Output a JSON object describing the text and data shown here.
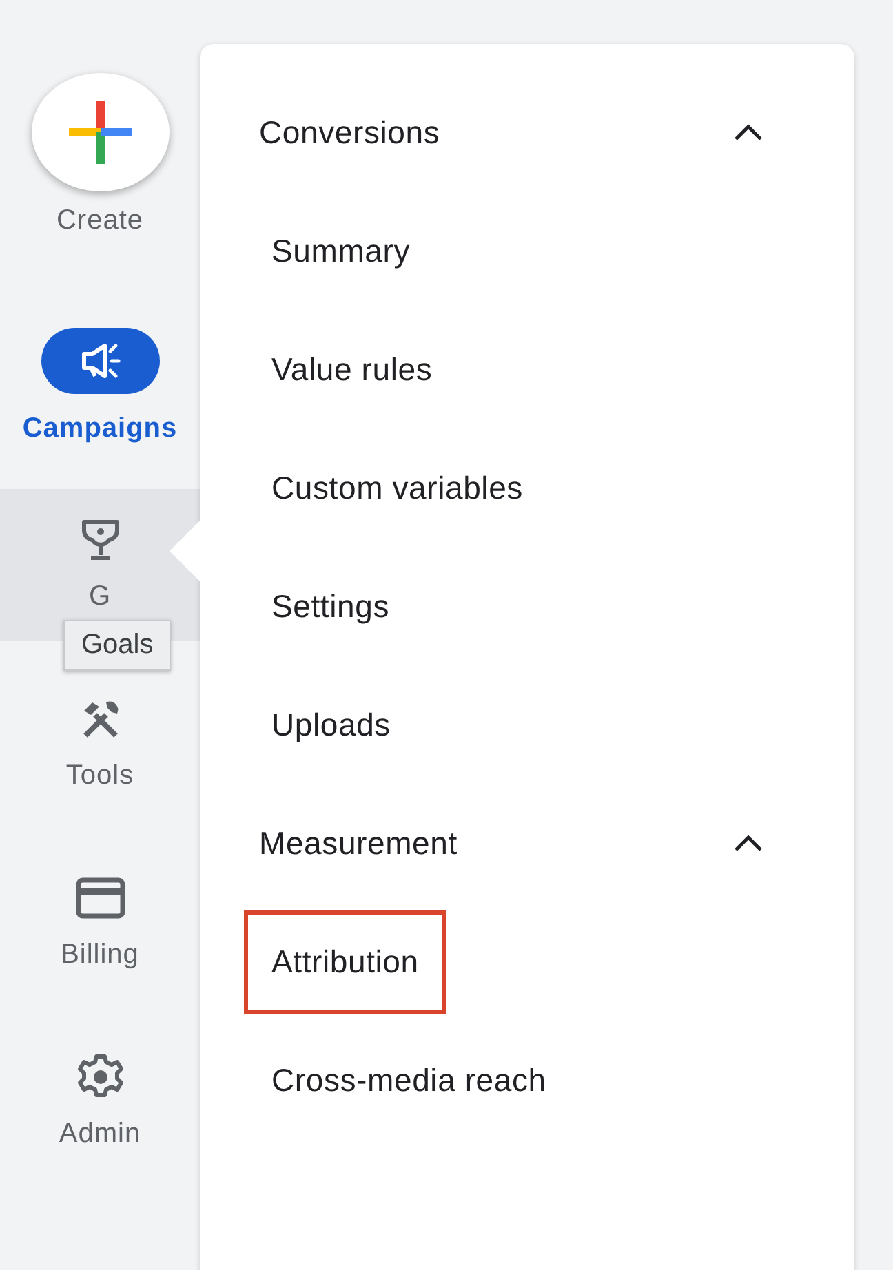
{
  "create": {
    "label": "Create"
  },
  "nav": [
    {
      "kind": "campaigns",
      "label": "Campaigns",
      "selected": true,
      "hovered": false
    },
    {
      "kind": "goals",
      "label": "G",
      "selected": false,
      "hovered": true
    },
    {
      "kind": "tools",
      "label": "Tools",
      "selected": false,
      "hovered": false
    },
    {
      "kind": "billing",
      "label": "Billing",
      "selected": false,
      "hovered": false
    },
    {
      "kind": "admin",
      "label": "Admin",
      "selected": false,
      "hovered": false
    }
  ],
  "tooltip": "Goals",
  "menu": [
    {
      "title": "Conversions",
      "expanded": true,
      "items": [
        {
          "label": "Summary",
          "highlighted": false
        },
        {
          "label": "Value rules",
          "highlighted": false
        },
        {
          "label": "Custom variables",
          "highlighted": false
        },
        {
          "label": "Settings",
          "highlighted": false
        },
        {
          "label": "Uploads",
          "highlighted": false
        }
      ]
    },
    {
      "title": "Measurement",
      "expanded": true,
      "items": [
        {
          "label": "Attribution",
          "highlighted": true
        },
        {
          "label": "Cross-media reach",
          "highlighted": false
        }
      ]
    }
  ]
}
